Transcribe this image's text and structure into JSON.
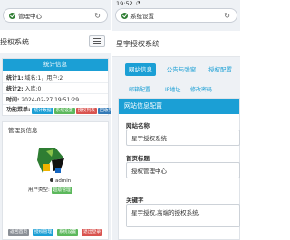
{
  "left": {
    "url": "管理中心",
    "brand": "授权系统",
    "stats_card": {
      "title": "统计信息",
      "rows": [
        {
          "label": "统计1:",
          "value": "域名:1，用户:2"
        },
        {
          "label": "统计2:",
          "value": "入库:0"
        },
        {
          "label": "时间:",
          "value": "2024-02-27 19:51:29"
        },
        {
          "label": "功能菜单:",
          "value": ""
        }
      ],
      "badges": [
        {
          "text": "统计数据",
          "color": "#1b9fd5"
        },
        {
          "text": "系统设置",
          "color": "#5cb85c"
        },
        {
          "text": "授权列表",
          "color": "#d9534f"
        },
        {
          "text": "回收列表",
          "color": "#337ab7"
        }
      ]
    },
    "admin_card": {
      "title": "管理员信息",
      "name": "admin",
      "user_type_label": "用户类型:",
      "user_type_value": "超级管理",
      "buttons": [
        {
          "text": "返回首页",
          "color": "#8a8f96"
        },
        {
          "text": "授权管理",
          "color": "#1b9fd5"
        },
        {
          "text": "系统设置",
          "color": "#5cb85c"
        },
        {
          "text": "退出登录",
          "color": "#d9534f"
        }
      ]
    }
  },
  "right": {
    "time": "19:52",
    "url": "系统设置",
    "brand": "星宇授权系统",
    "tabs": [
      "网站信息",
      "公告与弹窗",
      "授权配置"
    ],
    "active_tab": 0,
    "subtabs": [
      "邮箱配置",
      "IP地址",
      "修改密码"
    ],
    "form": {
      "title": "网站信息配置",
      "fields": [
        {
          "label": "网站名称",
          "value": "星宇授权系统"
        },
        {
          "label": "首页标题",
          "value": "授权管理中心"
        },
        {
          "label": "关键字",
          "value": "星宇授权,高端的授权系统,"
        }
      ]
    }
  },
  "colors": {
    "accent": "#1b9fd5",
    "success": "#5cb85c",
    "danger": "#d9534f"
  }
}
